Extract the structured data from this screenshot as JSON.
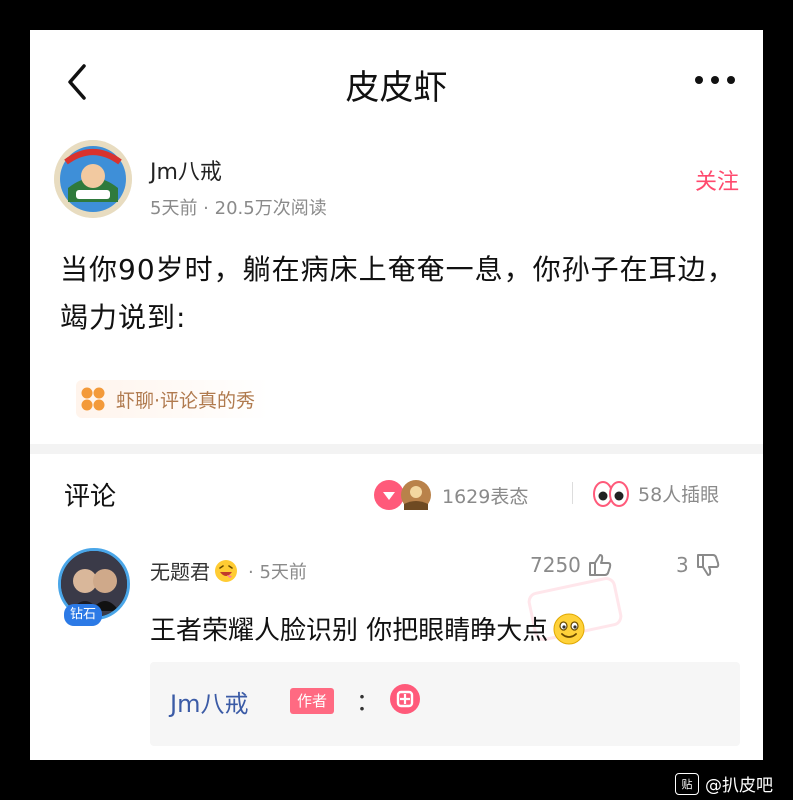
{
  "app": {
    "title": "皮皮虾"
  },
  "post": {
    "author": "Jm八戒",
    "time": "5天前",
    "meta_sep": " · ",
    "views": "20.5万次阅读",
    "follow_label": "关注",
    "text": "当你90岁时，躺在病床上奄奄一息，你孙子在耳边，竭力说到:",
    "topic": "虾聊·评论真的秀"
  },
  "comments": {
    "title": "评论",
    "reactions_count": "1629表态",
    "peek_count": "58人插眼",
    "items": [
      {
        "user": "无题君",
        "badge": "钻石",
        "time": "· 5天前",
        "likes": "7250",
        "dislikes": "3",
        "text": "王者荣耀人脸识别 你把眼睛睁大点",
        "reply": {
          "user": "Jm八戒",
          "tag": "作者",
          "colon": "："
        }
      }
    ]
  },
  "watermark": {
    "icon": "贴",
    "text": "@扒皮吧"
  },
  "colors": {
    "accent": "#ff4a6e",
    "author_tag": "#ff6a82",
    "reply_name": "#3b5ba6"
  },
  "icons": [
    "back-arrow-icon",
    "more-icon",
    "topic-grid-icon",
    "reaction-icon",
    "eyes-icon",
    "thumb-up-icon",
    "thumb-down-icon",
    "grin-emoji-icon",
    "smile-emoji-icon",
    "pipixia-emoji-icon"
  ]
}
